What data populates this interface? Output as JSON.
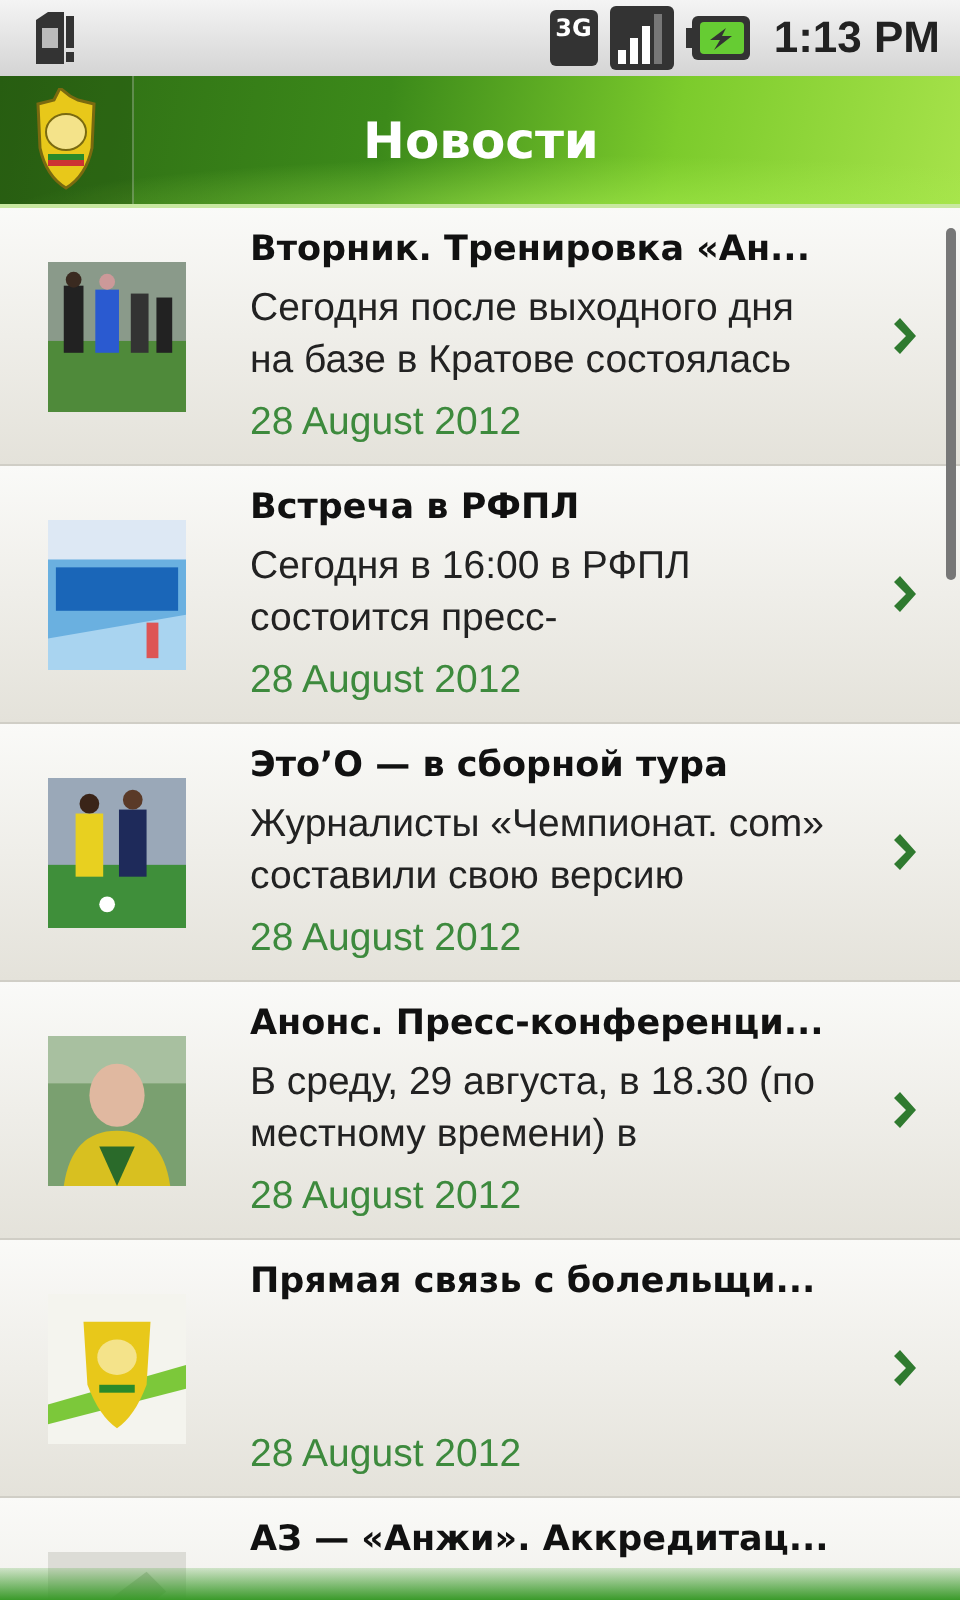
{
  "status_bar": {
    "network": "3G",
    "time": "1:13 PM"
  },
  "header": {
    "title": "Новости"
  },
  "news": [
    {
      "title": "Вторник. Тренировка «Ан...",
      "summary": "Сегодня после выходного дня на базе в Кратове состоялась",
      "date": "28 August 2012",
      "kind": "picture"
    },
    {
      "title": "Встреча в РФПЛ",
      "summary": "Сегодня в 16:00 в РФПЛ состоится пресс-",
      "date": "28 August 2012",
      "kind": "picture"
    },
    {
      "title": "Это’О — в сборной тура",
      "summary": "Журналисты «Чемпионат. com» составили свою версию",
      "date": "28 August 2012",
      "kind": "picture"
    },
    {
      "title": "Анонс. Пресс-конференци...",
      "summary": "В среду, 29 августа, в 18.30 (по местному времени) в",
      "date": "28 August 2012",
      "kind": "picture"
    },
    {
      "title": "Прямая связь с болельщи...",
      "date": "28 August 2012",
      "kind": "picture"
    },
    {
      "title": "АЗ — «Анжи». Аккредитац...",
      "kind": "picture"
    }
  ]
}
